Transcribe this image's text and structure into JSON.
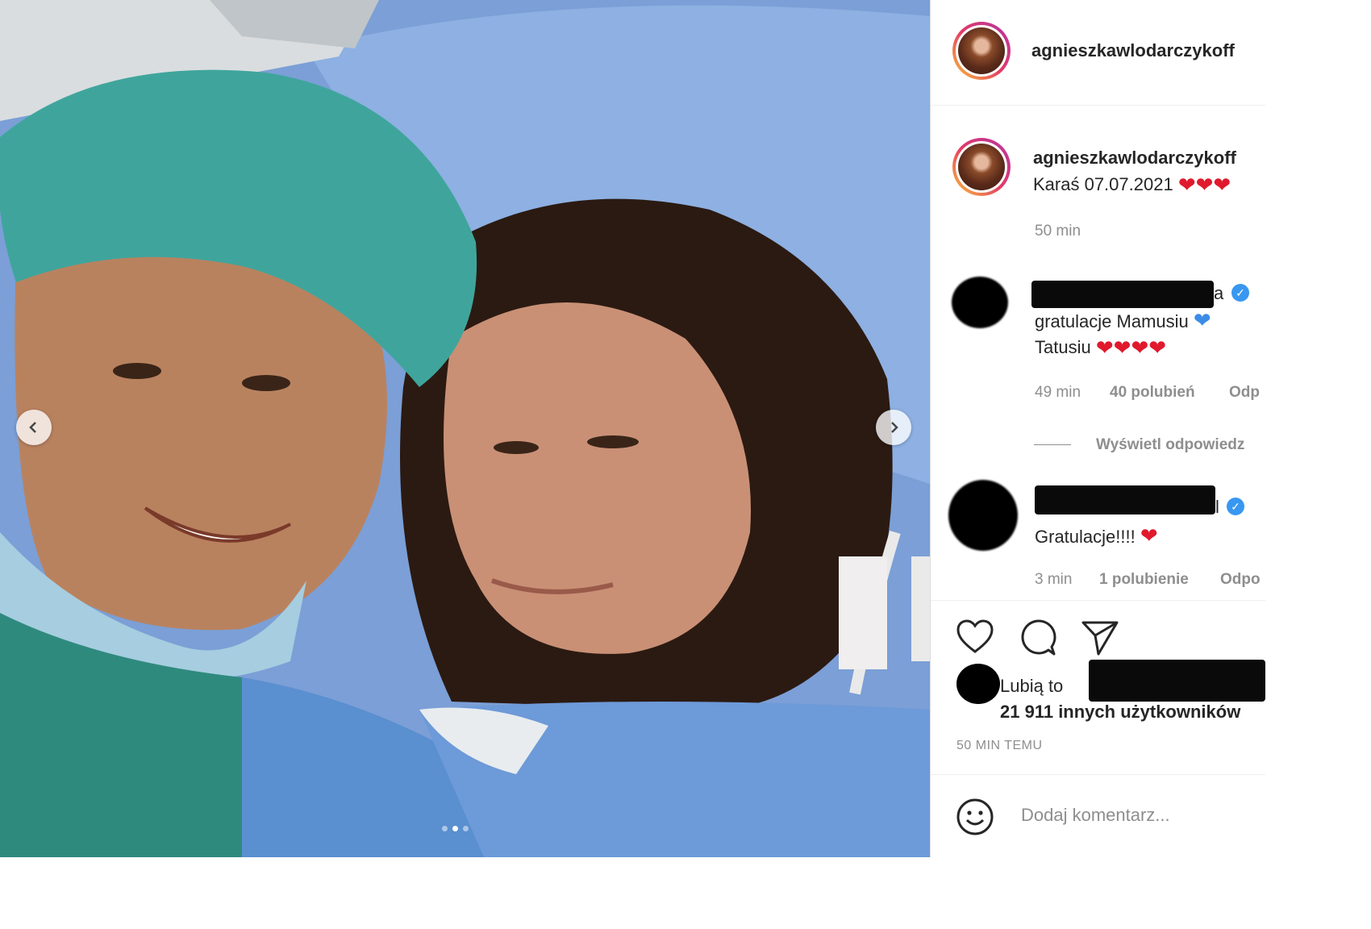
{
  "post": {
    "username": "agnieszkawlodarczykoff",
    "caption": "Karaś 07.07.2021",
    "caption_time": "50 min",
    "slide_count": 3,
    "active_slide": 2
  },
  "comments": [
    {
      "text_line1": "gratulacje Mamusiu",
      "text_line2": "Tatusiu",
      "time": "49 min",
      "likes": "40 polubień",
      "reply": "Odp",
      "view_replies": "Wyświetl odpowiedz"
    },
    {
      "text": "Gratulacje!!!!",
      "time": "3 min",
      "likes": "1 polubienie",
      "reply": "Odpo"
    }
  ],
  "liked_by": {
    "prefix": "Lubią to",
    "others": "21 911 innych użytkowników"
  },
  "timestamp": "50 MIN TEMU",
  "comment_box": {
    "placeholder": "Dodaj komentarz..."
  },
  "colors": {
    "heart_red": "#e0192d",
    "heart_blue": "#3c8ce7",
    "verified": "#3897f0"
  }
}
